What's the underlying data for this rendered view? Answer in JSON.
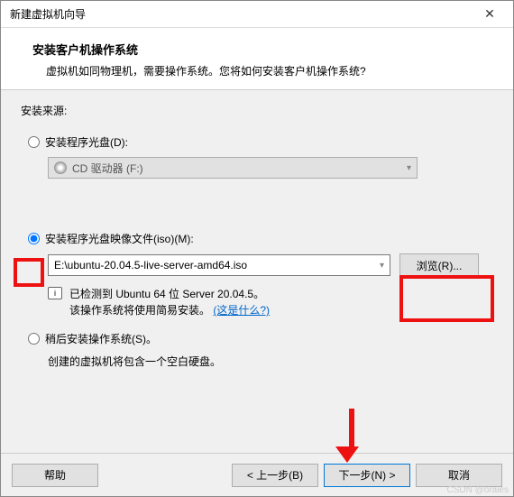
{
  "titlebar": {
    "title": "新建虚拟机向导",
    "close": "✕"
  },
  "header": {
    "title": "安装客户机操作系统",
    "desc": "虚拟机如同物理机，需要操作系统。您将如何安装客户机操作系统?"
  },
  "source": {
    "label": "安装来源:",
    "radio_disc_label": "安装程序光盘(D):",
    "disc_dropdown_text": "CD 驱动器 (F:)",
    "radio_iso_label": "安装程序光盘映像文件(iso)(M):",
    "iso_path": "E:\\ubuntu-20.04.5-live-server-amd64.iso",
    "browse_label": "浏览(R)...",
    "detect_line1": "已检测到 Ubuntu 64 位 Server 20.04.5。",
    "detect_line2_prefix": "该操作系统将使用简易安装。",
    "detect_link": "(这是什么?)",
    "radio_later_label": "稍后安装操作系统(S)。",
    "later_desc": "创建的虚拟机将包含一个空白硬盘。"
  },
  "footer": {
    "help": "帮助",
    "back": "< 上一步(B)",
    "next": "下一步(N) >",
    "cancel": "取消"
  },
  "watermark": "CSDN @orales"
}
